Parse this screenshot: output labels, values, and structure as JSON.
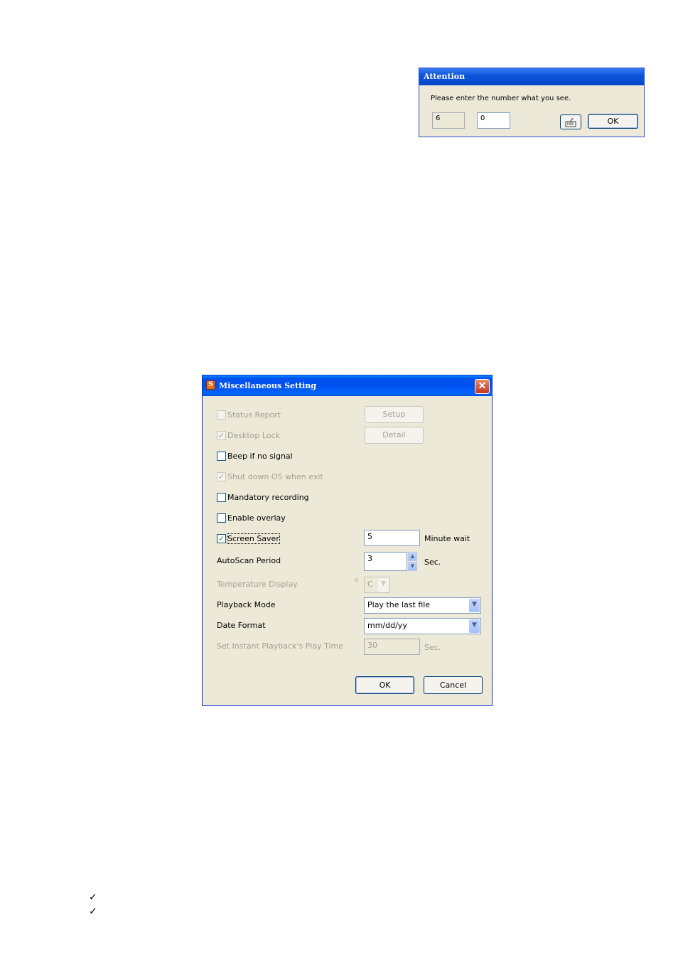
{
  "attention": {
    "title": "Attention",
    "message": "Please enter the number what you see.",
    "shown_number": "6",
    "input_value": "0",
    "ok_label": "OK"
  },
  "misc": {
    "title": "Miscellaneous Setting",
    "status_report": {
      "label": "Status Report",
      "checked": false,
      "enabled": false
    },
    "setup_label": "Setup",
    "desktop_lock": {
      "label": "Desktop Lock",
      "checked": true,
      "enabled": false
    },
    "detail_label": "Detail",
    "beep": {
      "label": "Beep if no signal",
      "checked": false,
      "enabled": true
    },
    "shutdown": {
      "label": "Shut down OS when exit",
      "checked": true,
      "enabled": false
    },
    "mandatory": {
      "label": "Mandatory recording",
      "checked": false,
      "enabled": true
    },
    "overlay": {
      "label": "Enable overlay",
      "checked": false,
      "enabled": true
    },
    "screensaver": {
      "label": "Screen Saver",
      "checked": true,
      "enabled": true,
      "value": "5",
      "unit": "Minute wait"
    },
    "autoscan": {
      "label": "AutoScan Period",
      "value": "3",
      "unit": "Sec."
    },
    "temperature": {
      "label": "Temperature Display",
      "degree": "o",
      "value": "C"
    },
    "playback_mode": {
      "label": "Playback Mode",
      "value": "Play the last file"
    },
    "date_format": {
      "label": "Date Format",
      "value": "mm/dd/yy"
    },
    "instant_playback": {
      "label": "Set Instant Playback's Play Time",
      "value": "30",
      "unit": "Sec."
    },
    "ok_label": "OK",
    "cancel_label": "Cancel"
  },
  "bullets": [
    "✓",
    "✓"
  ]
}
